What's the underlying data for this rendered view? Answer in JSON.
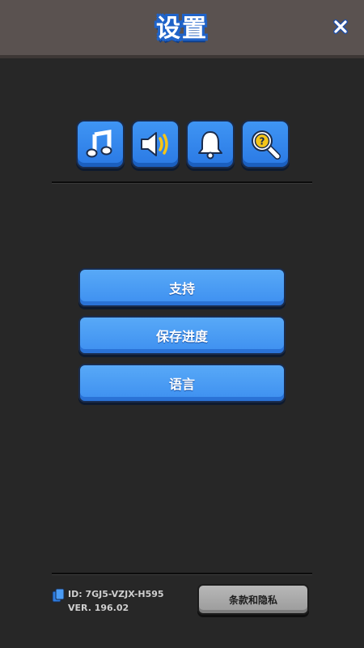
{
  "header": {
    "title": "设置"
  },
  "icons": [
    {
      "name": "music-icon"
    },
    {
      "name": "sound-icon"
    },
    {
      "name": "notification-bell-icon"
    },
    {
      "name": "help-search-icon"
    }
  ],
  "menu": {
    "support_label": "支持",
    "save_progress_label": "保存进度",
    "language_label": "语言"
  },
  "footer": {
    "id_text": "ID: 7GJ5-VZJX-H595",
    "version_text": "VER. 196.02",
    "terms_label": "条款和隐私"
  },
  "colors": {
    "accent_blue": "#3d8ff0",
    "title_outline": "#1f63c9",
    "background": "#272727",
    "header": "#5a5250"
  }
}
